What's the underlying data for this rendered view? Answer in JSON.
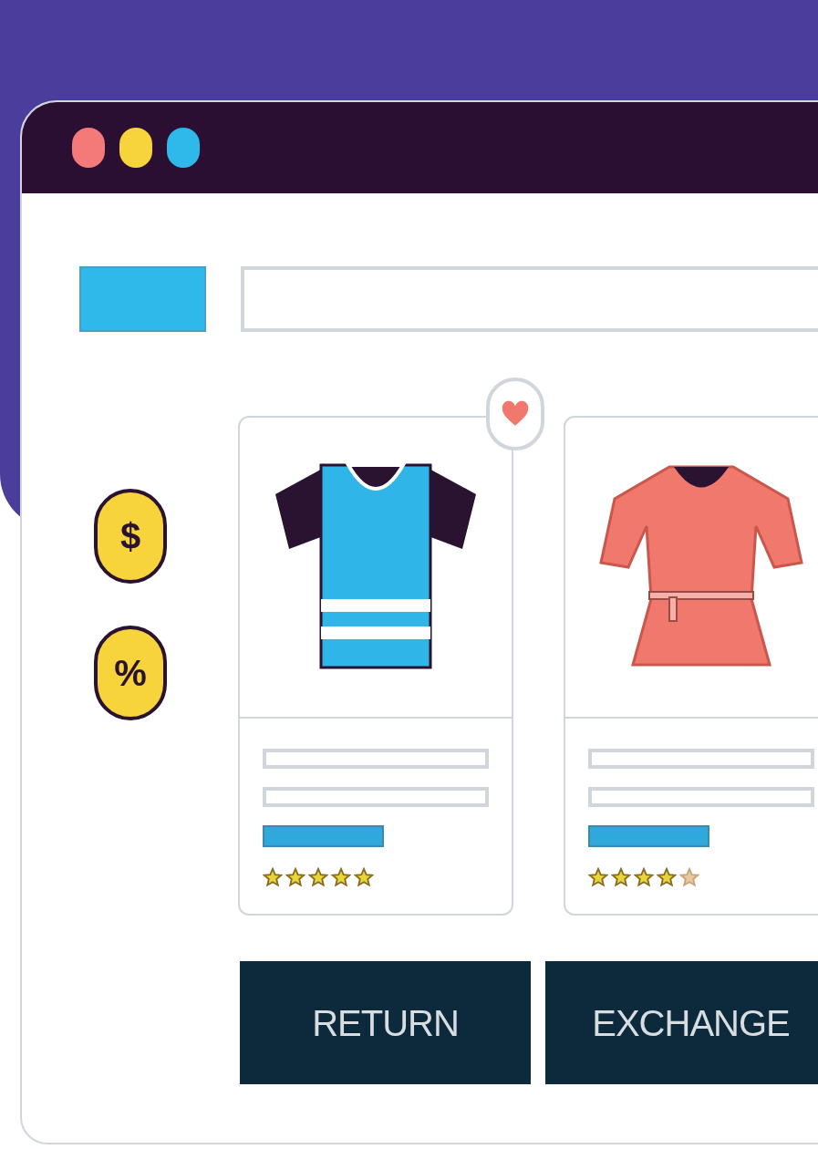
{
  "window": {
    "dots": [
      {
        "color": "#f47a7a"
      },
      {
        "color": "#f7d33c"
      },
      {
        "color": "#2fb8ea"
      }
    ]
  },
  "side_badges": [
    "$",
    "%"
  ],
  "products": [
    {
      "kind": "tshirt",
      "favorite": true,
      "stars": 5
    },
    {
      "kind": "dress",
      "favorite": false,
      "stars": 4
    }
  ],
  "buttons": [
    "RETURN",
    "EXCHANGE"
  ]
}
